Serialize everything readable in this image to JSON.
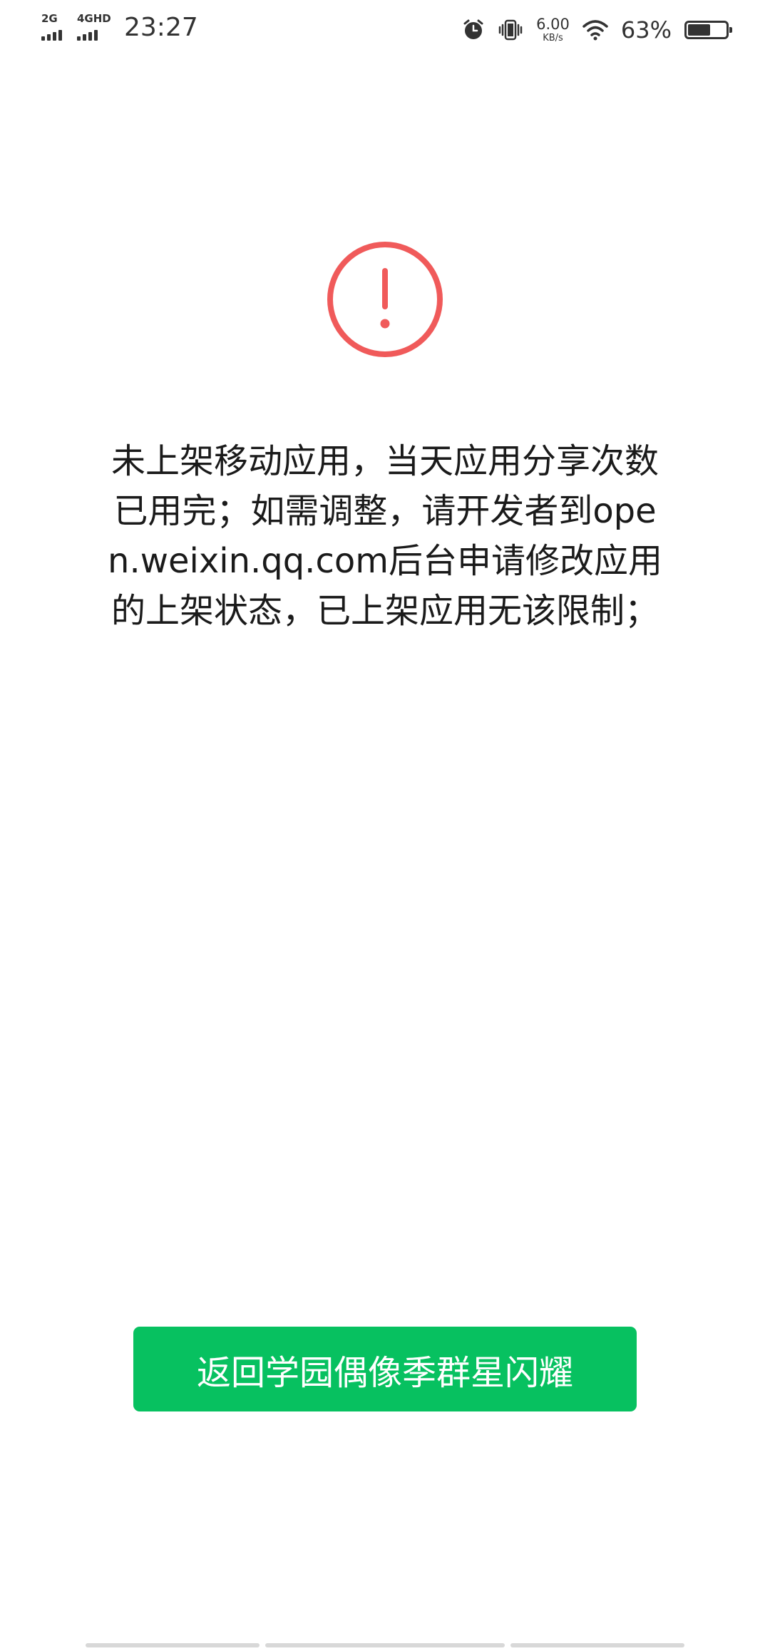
{
  "status_bar": {
    "sim1_label": "2G",
    "sim2_label": "4GHD",
    "time": "23:27",
    "speed_value": "6.00",
    "speed_unit": "KB/s",
    "battery_percent": "63%",
    "battery_level": 0.63,
    "icons": [
      "signal-icon",
      "signal-icon",
      "alarm-icon",
      "vibrate-icon",
      "wifi-icon",
      "battery-icon"
    ]
  },
  "main": {
    "warning_icon": "warning-circle-icon",
    "warning_color": "#f05a5a",
    "message": "未上架移动应用，当天应用分享次数已用完；如需调整，请开发者到open.weixin.qq.com后台申请修改应用的上架状态，已上架应用无该限制；",
    "button_label": "返回学园偶像季群星闪耀",
    "button_color": "#07c160"
  }
}
